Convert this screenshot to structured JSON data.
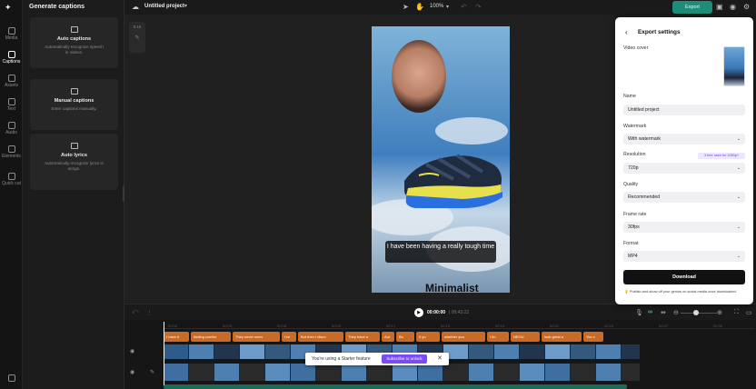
{
  "rail": {
    "items": [
      {
        "label": "Media",
        "icon": "media-icon"
      },
      {
        "label": "Captions",
        "icon": "captions-icon"
      },
      {
        "label": "Assets",
        "icon": "assets-icon"
      },
      {
        "label": "Text",
        "icon": "text-icon"
      },
      {
        "label": "Audio",
        "icon": "audio-icon"
      },
      {
        "label": "Elements",
        "icon": "elements-icon"
      },
      {
        "label": "Quick cut",
        "icon": "quick-cut-icon"
      }
    ]
  },
  "panel": {
    "title": "Generate captions",
    "cards": [
      {
        "title": "Auto captions",
        "desc": "Automatically recognize speech in videos."
      },
      {
        "title": "Manual captions",
        "desc": "Enter captions manually."
      },
      {
        "title": "Auto lyrics",
        "desc": "Automatically recognize lyrics in songs."
      }
    ]
  },
  "topbar": {
    "project_name": "Untitled project",
    "zoom": "100%",
    "export_label": "Export"
  },
  "side_tools": {
    "ratio": "9:16"
  },
  "video": {
    "subtitle": "I have been having a really tough time",
    "brand_text": "Minimalist"
  },
  "playback": {
    "current": "00:00:00",
    "total": "| 00:43:22"
  },
  "timeline": {
    "ticks": [
      "00:00",
      "00:03",
      "00:06",
      "00:09",
      "00:12",
      "00:15",
      "00:18",
      "00:21",
      "00:24",
      "00:27",
      "00:30"
    ],
    "captions": [
      "I have b",
      "finding comfor",
      "They never seen",
      "I've",
      "But then I disco",
      "They have a",
      "Aut",
      "Bu",
      "It yo",
      "whether you",
      "I fin",
      "NEOU",
      "look great a",
      "You c"
    ]
  },
  "toast": {
    "text": "You're using a Starter feature",
    "button": "Subscribe to unlock"
  },
  "export": {
    "title": "Export settings",
    "video_cover_label": "Video cover",
    "name_label": "Name",
    "name_value": "Untitled project",
    "watermark_label": "Watermark",
    "watermark_value": "With watermark",
    "resolution_label": "Resolution",
    "resolution_badge": "3 free uses for 1080p+",
    "resolution_value": "720p",
    "quality_label": "Quality",
    "quality_value": "Recommended",
    "framerate_label": "Frame rate",
    "framerate_value": "30fps",
    "format_label": "Format",
    "format_value": "MP4",
    "download_label": "Download",
    "note": "Publish and show off your genius on social media once downloaded."
  }
}
